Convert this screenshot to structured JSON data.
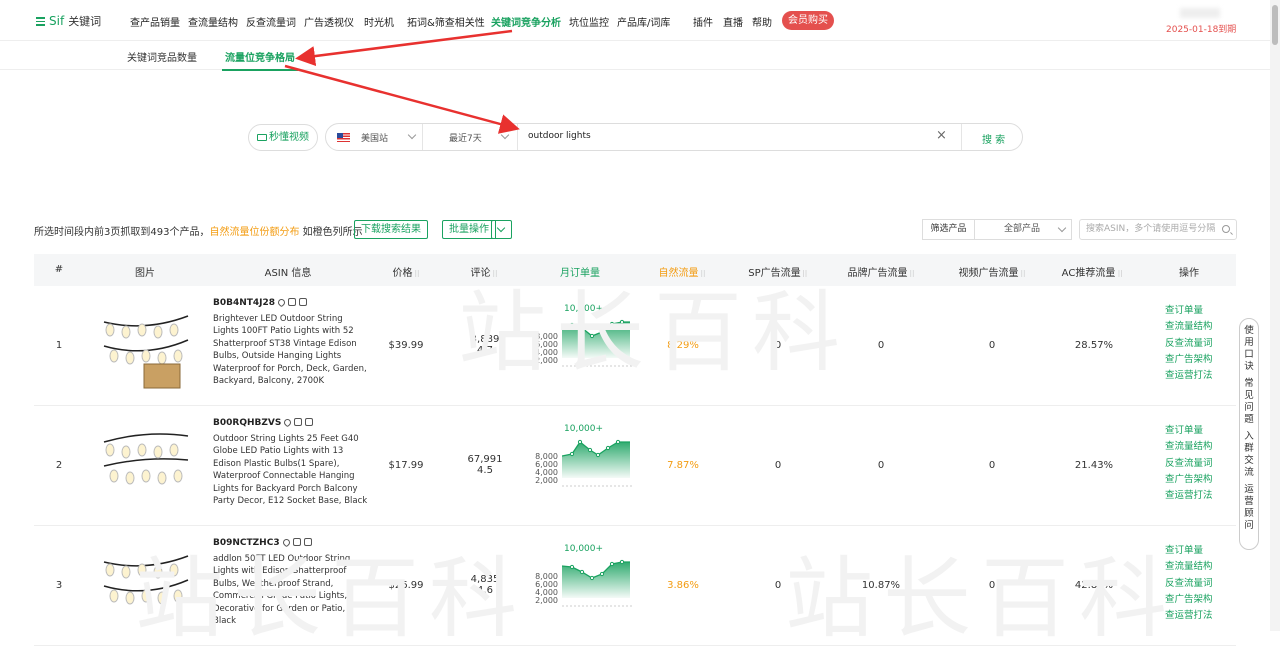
{
  "nav": {
    "brand": "Sif",
    "brand_sub": "关键词",
    "items": [
      "查产品销量",
      "查流量结构",
      "反查流量词",
      "广告透视仪",
      "时光机",
      "拓词&筛查相关性",
      "关键词竞争分析",
      "坑位监控",
      "产品库/词库",
      "插件",
      "直播",
      "帮助"
    ],
    "active_item": "关键词竞争分析",
    "buy_label": "会员购买",
    "expiry": "2025-01-18到期"
  },
  "subtabs": [
    "关键词竞品数量",
    "流量位竞争格局"
  ],
  "search": {
    "video_label": "秒懂视频",
    "site": "美国站",
    "period": "最近7天",
    "query": "outdoor lights",
    "clear": "×",
    "button": "搜 索"
  },
  "toolbar": {
    "info_prefix": "所选时间段内前3页抓取到493个产品，",
    "info_orange": "自然流量位份额分布",
    "info_suffix": " 如橙色列所示",
    "download": "下载搜索结果",
    "bulk": "批量操作",
    "filter_label": "筛选产品",
    "filter_value": "全部产品",
    "asin_placeholder": "搜索ASIN，多个请使用逗号分隔"
  },
  "table": {
    "headers": [
      "#",
      "图片",
      "ASIN 信息",
      "价格",
      "评论",
      "月订单量",
      "自然流量",
      "SP广告流量",
      "品牌广告流量",
      "视频广告流量",
      "AC推荐流量",
      "操作"
    ],
    "ops": [
      "查订单量",
      "查流量结构",
      "反查流量词",
      "查广告架构",
      "查运营打法"
    ],
    "chart_top": "10,000+",
    "chart_axis": [
      "8,000",
      "6,000",
      "4,000",
      "2,000"
    ],
    "rows": [
      {
        "rank": "1",
        "asin": "B0B4NT4J28",
        "title": "Brightever LED Outdoor String Lights 100FT Patio Lights with 52 Shatterproof ST38 Vintage Edison Bulbs, Outside Hanging Lights Waterproof for Porch, Deck, Garden, Backyard, Balcony, 2700K",
        "price": "$39.99",
        "reviews": "3,889",
        "rating": "4.7",
        "organic": "8.29%",
        "sp": "0",
        "brand": "0",
        "video": "0",
        "ac": "28.57%"
      },
      {
        "rank": "2",
        "asin": "B00RQHBZVS",
        "title": "Outdoor String Lights 25 Feet G40 Globe LED Patio Lights with 13 Edison Plastic Bulbs(1 Spare), Waterproof Connectable Hanging Lights for Backyard Porch Balcony Party Decor, E12 Socket Base, Black",
        "price": "$17.99",
        "reviews": "67,991",
        "rating": "4.5",
        "organic": "7.87%",
        "sp": "0",
        "brand": "0",
        "video": "0",
        "ac": "21.43%"
      },
      {
        "rank": "3",
        "asin": "B09NCTZHC3",
        "title": "addlon 50FT LED Outdoor String Lights with Edison Shatterproof Bulbs, Weatherproof Strand, Commercial Grade Patio Lights, Decorative for Garden or Patio, Black",
        "price": "$26.99",
        "reviews": "4,835",
        "rating": "4.6",
        "organic": "3.86%",
        "sp": "0",
        "brand": "10.87%",
        "video": "0",
        "ac": "42.86%"
      }
    ]
  },
  "help": [
    "使用口诀",
    "常见问题",
    "入群交流",
    "运营顾问"
  ],
  "watermark": "站长百科"
}
